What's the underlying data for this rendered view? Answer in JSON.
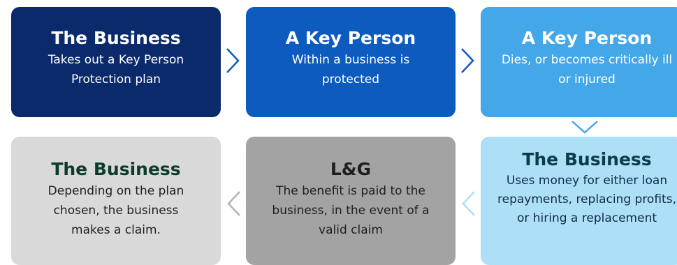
{
  "steps": [
    {
      "title": "The Business",
      "desc": "Takes out a Key Person Protection plan",
      "color": "#0a2a6b"
    },
    {
      "title": "A Key Person",
      "desc": "Within a business is protected",
      "color": "#0d5bbf"
    },
    {
      "title": "A Key Person",
      "desc": "Dies, or becomes critically ill or injured",
      "color": "#44a7e8"
    },
    {
      "title": "The Business",
      "desc": "Uses money for either loan repayments, replacing profits, or hiring a replacement",
      "color": "#ade0f6"
    },
    {
      "title": "L&G",
      "desc": "The benefit is paid to the business, in the event of a valid claim",
      "color": "#a3a3a3"
    },
    {
      "title": "The Business",
      "desc": "Depending on the plan chosen, the business makes a claim.",
      "color": "#d9d9d9"
    }
  ],
  "arrows": [
    {
      "icon": "chevron-right-icon",
      "color": "#0d5bbf"
    },
    {
      "icon": "chevron-right-icon",
      "color": "#0d5bbf"
    },
    {
      "icon": "chevron-down-icon",
      "color": "#44a7e8"
    },
    {
      "icon": "chevron-left-icon",
      "color": "#ade0f6"
    },
    {
      "icon": "chevron-left-icon",
      "color": "#b3b3b3"
    }
  ]
}
